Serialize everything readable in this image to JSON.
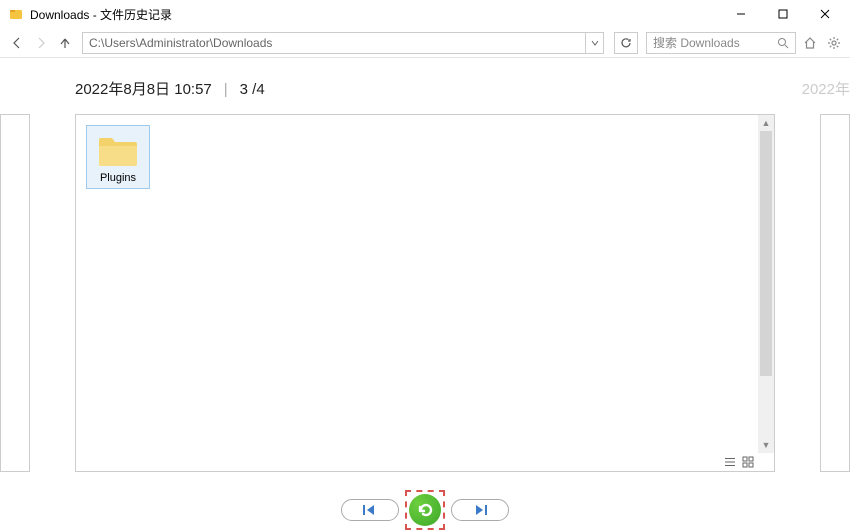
{
  "titlebar": {
    "title": "Downloads - 文件历史记录"
  },
  "toolbar": {
    "address": "C:\\Users\\Administrator\\Downloads",
    "search_placeholder": "搜索 Downloads"
  },
  "main": {
    "timestamp": "2022年8月8日 10:57",
    "page_indicator": "3 /4",
    "next_timestamp_preview": "2022年",
    "items": [
      {
        "label": "Plugins",
        "type": "folder"
      }
    ]
  }
}
